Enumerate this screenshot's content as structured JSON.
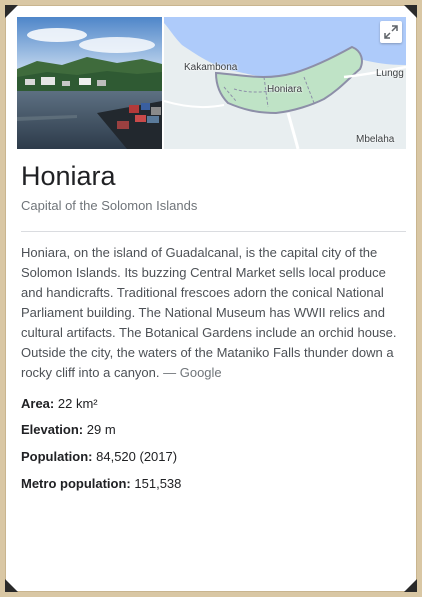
{
  "place": {
    "title": "Honiara",
    "subtitle": "Capital of the Solomon Islands"
  },
  "map": {
    "labels": {
      "kakambona": "Kakambona",
      "honiara": "Honiara",
      "lungga": "Lungg",
      "mbelaha": "Mbelaha"
    }
  },
  "description": {
    "text": "Honiara, on the island of Guadalcanal, is the capital city of the Solomon Islands. Its buzzing Central Market sells local produce and handicrafts. Traditional frescoes adorn the conical National Parliament building. The National Museum has WWII relics and cultural artifacts. The Botanical Gardens include an orchid house. Outside the city, the waters of the Mataniko Falls thunder down a rocky cliff into a canyon.",
    "source": "— Google"
  },
  "facts": [
    {
      "label": "Area:",
      "value": "22 km²"
    },
    {
      "label": "Elevation:",
      "value": "29 m"
    },
    {
      "label": "Population:",
      "value": "84,520 (2017)"
    },
    {
      "label": "Metro population:",
      "value": "151,538"
    }
  ],
  "colors": {
    "map_water": "#aecbfa",
    "map_land": "#e8eef0",
    "map_city": "#bfe3c6"
  }
}
